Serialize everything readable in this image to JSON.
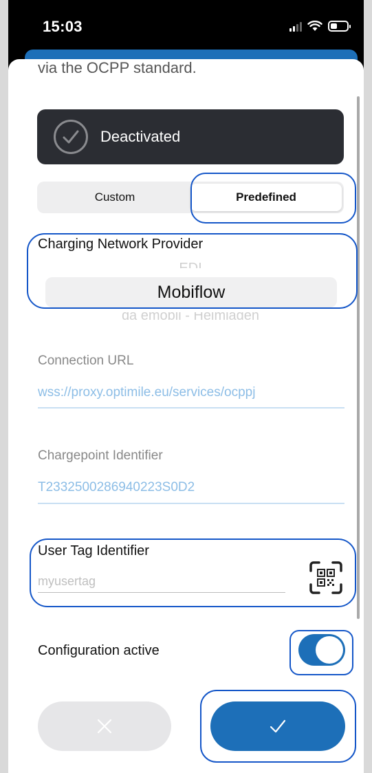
{
  "status_bar": {
    "time": "15:03",
    "icons": [
      "signal-icon",
      "wifi-icon",
      "battery-icon"
    ]
  },
  "sheet": {
    "intro_text": "via the OCPP standard.",
    "status": {
      "label": "Deactivated",
      "icon": "check-circle-icon"
    },
    "mode_tabs": [
      {
        "label": "Custom",
        "selected": false
      },
      {
        "label": "Predefined",
        "selected": true
      }
    ],
    "provider": {
      "label": "Charging Network Provider",
      "options_visible": [
        "EDI",
        "Mobiflow",
        "da emobil - Heimladen"
      ],
      "selected": "Mobiflow"
    },
    "connection_url": {
      "label": "Connection URL",
      "value": "wss://proxy.optimile.eu/services/ocppj"
    },
    "chargepoint_id": {
      "label": "Chargepoint Identifier",
      "value": "T2332500286940223S0D2"
    },
    "user_tag": {
      "label": "User Tag Identifier",
      "placeholder": "myusertag",
      "value": "",
      "scan_icon": "qr-scan-icon"
    },
    "config_active": {
      "label": "Configuration active",
      "enabled": true
    },
    "actions": {
      "cancel_icon": "close-icon",
      "confirm_icon": "checkmark-icon"
    }
  },
  "colors": {
    "accent": "#1d6fb8",
    "highlight": "#1456c8",
    "dark_pill": "#2b2d33",
    "disabled_text": "#8cbde6"
  }
}
